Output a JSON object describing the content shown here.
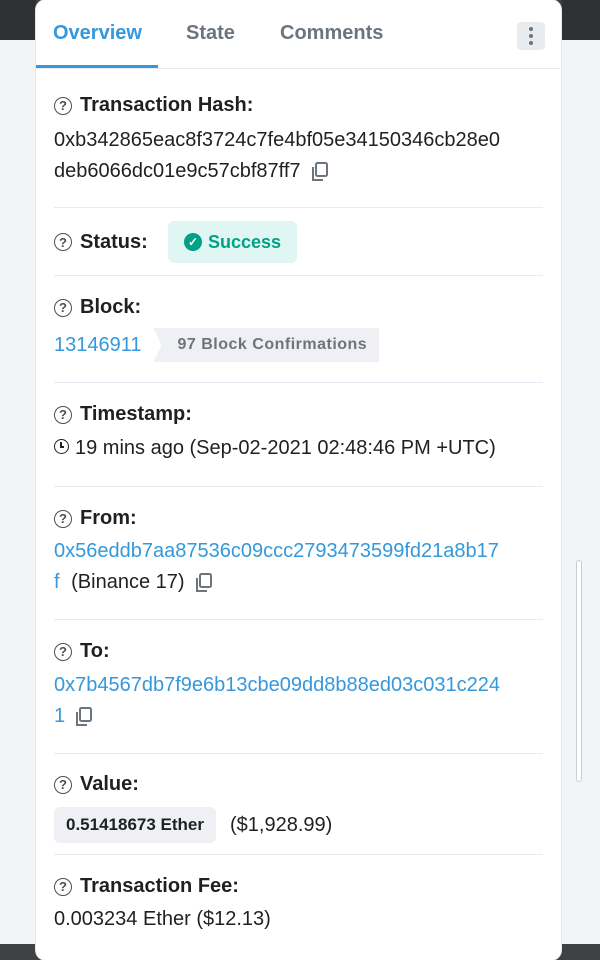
{
  "tabs": [
    "Overview",
    "State",
    "Comments"
  ],
  "tx_hash": {
    "label": "Transaction Hash:",
    "line1": "0xb342865eac8f3724c7fe4bf05e34150346cb28e0",
    "line2": "deb6066dc01e9c57cbf87ff7"
  },
  "status": {
    "label": "Status:",
    "value": "Success"
  },
  "block": {
    "label": "Block:",
    "number": "13146911",
    "confirmations": "97 Block Confirmations"
  },
  "timestamp": {
    "label": "Timestamp:",
    "value": "19 mins ago (Sep-02-2021 02:48:46 PM +UTC)"
  },
  "from": {
    "label": "From:",
    "line1": "0x56eddb7aa87536c09ccc2793473599fd21a8b17",
    "line2": "f",
    "name": "(Binance 17)"
  },
  "to": {
    "label": "To:",
    "line1": "0x7b4567db7f9e6b13cbe09dd8b88ed03c031c224",
    "line2": "1"
  },
  "value": {
    "label": "Value:",
    "ether": "0.51418673 Ether",
    "usd": "($1,928.99)"
  },
  "fee": {
    "label": "Transaction Fee:",
    "value": "0.003234 Ether ($12.13)"
  },
  "colors": {
    "link": "#3498db",
    "success": "#00a186",
    "success_bg": "#dff6f3"
  }
}
